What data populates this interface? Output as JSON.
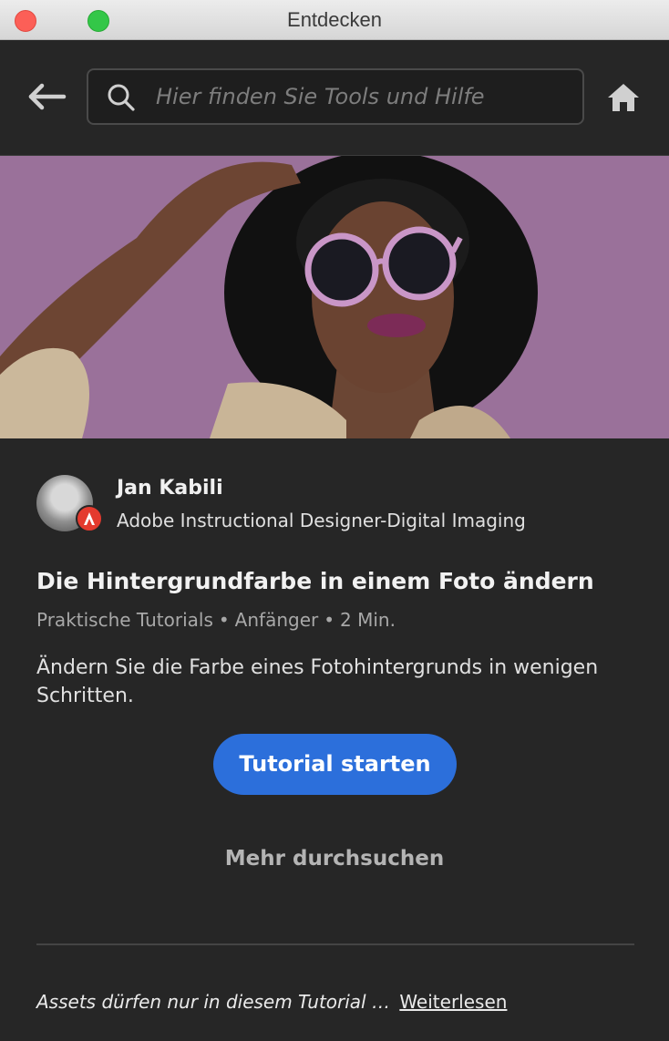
{
  "window": {
    "title": "Entdecken"
  },
  "toolbar": {
    "back_icon": "arrow-left-icon",
    "search_placeholder": "Hier finden Sie Tools und Hilfe",
    "search_value": "",
    "search_icon": "search-icon",
    "home_icon": "home-icon"
  },
  "hero": {
    "background_color": "#9a719a"
  },
  "author": {
    "name": "Jan Kabili",
    "title": "Adobe Instructional Designer-Digital Imaging",
    "badge_icon": "adobe-icon"
  },
  "tutorial": {
    "title": "Die Hintergrundfarbe in einem Foto ändern",
    "category": "Praktische Tutorials",
    "level": "Anfänger",
    "duration": "2 Min.",
    "separator": "•",
    "description": "Ändern Sie die Farbe eines Fotohintergrunds in wenigen Schritten.",
    "start_label": "Tutorial starten",
    "start_color": "#2c6fdb"
  },
  "browse": {
    "label": "Mehr durchsuchen"
  },
  "footer": {
    "note": "Assets dürfen nur in diesem Tutorial …",
    "read_more": "Weiterlesen"
  }
}
